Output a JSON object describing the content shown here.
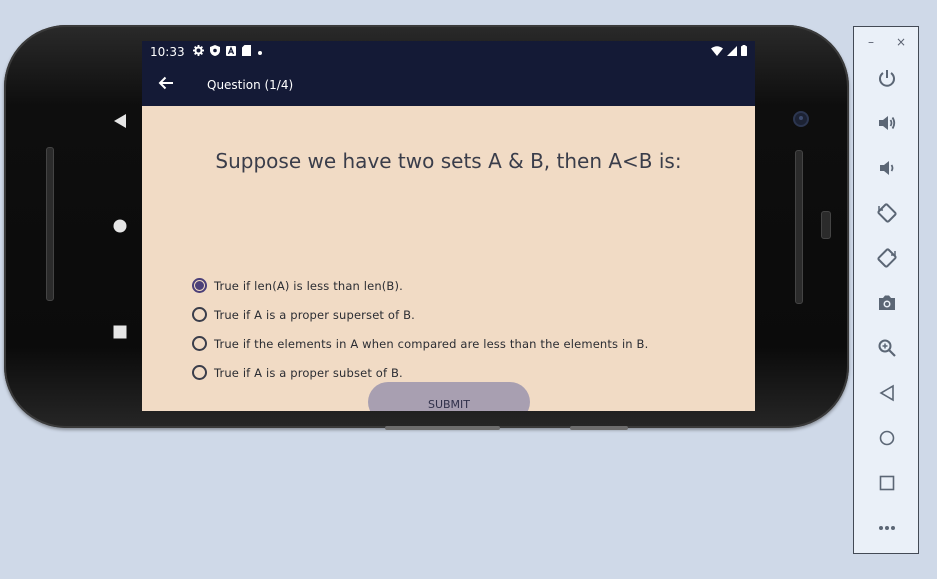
{
  "status_bar": {
    "time": "10:33"
  },
  "app_bar": {
    "title": "Question (1/4)"
  },
  "question": {
    "text": "Suppose we have two sets A & B, then A<B is:"
  },
  "options": [
    {
      "label": "True if len(A) is less than len(B).",
      "selected": true
    },
    {
      "label": "True if A is a proper superset of B.",
      "selected": false
    },
    {
      "label": "True if the elements in A when compared are less than the elements in B.",
      "selected": false
    },
    {
      "label": "True if A is a proper subset of B.",
      "selected": false
    }
  ],
  "submit": {
    "label": "SUBMIT"
  },
  "emulator_toolbar": {
    "minimize": "–",
    "close": "×",
    "items": [
      "power-icon",
      "volume-up-icon",
      "volume-down-icon",
      "rotate-left-icon",
      "rotate-right-icon",
      "camera-icon",
      "zoom-icon",
      "back-icon",
      "home-icon",
      "overview-icon",
      "more-icon"
    ]
  },
  "colors": {
    "screen_background": "#f1dbc5",
    "app_bar": "#141a36",
    "accent": "#4b3f78",
    "submit_button": "#a89fb1"
  }
}
